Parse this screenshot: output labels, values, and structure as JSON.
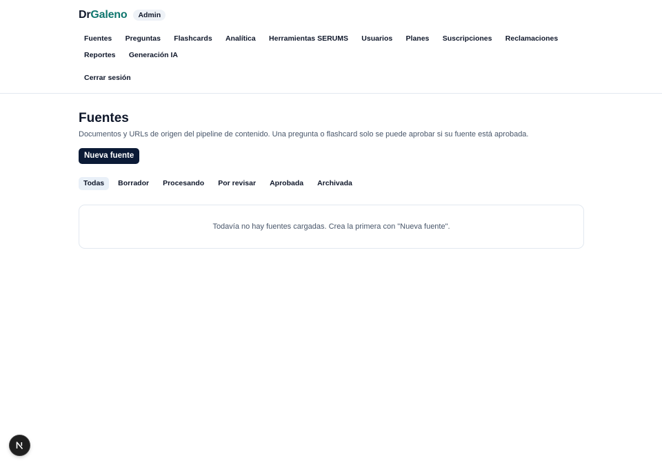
{
  "brand": {
    "part1": "Dr",
    "part2": "Galeno",
    "badge": "Admin"
  },
  "nav": {
    "items": [
      {
        "label": "Fuentes"
      },
      {
        "label": "Preguntas"
      },
      {
        "label": "Flashcards"
      },
      {
        "label": "Analítica"
      },
      {
        "label": "Herramientas SERUMS"
      },
      {
        "label": "Usuarios"
      },
      {
        "label": "Planes"
      },
      {
        "label": "Suscripciones"
      },
      {
        "label": "Reclamaciones"
      },
      {
        "label": "Reportes"
      },
      {
        "label": "Generación IA"
      }
    ],
    "logout": "Cerrar sesión"
  },
  "main": {
    "title": "Fuentes",
    "description": "Documentos y URLs de origen del pipeline de contenido. Una pregunta o flashcard solo se puede aprobar si su fuente está aprobada.",
    "new_button": "Nueva fuente",
    "filters": [
      {
        "label": "Todas",
        "active": true
      },
      {
        "label": "Borrador",
        "active": false
      },
      {
        "label": "Procesando",
        "active": false
      },
      {
        "label": "Por revisar",
        "active": false
      },
      {
        "label": "Aprobada",
        "active": false
      },
      {
        "label": "Archivada",
        "active": false
      }
    ],
    "empty_message": "Todavía no hay fuentes cargadas. Crea la primera con \"Nueva fuente\"."
  },
  "colors": {
    "brand_accent": "#0f766e",
    "primary_button": "#0b1a36",
    "active_tab_bg": "#e9f0f8"
  },
  "icons": {
    "dev_indicator": "nextjs-n-icon"
  }
}
